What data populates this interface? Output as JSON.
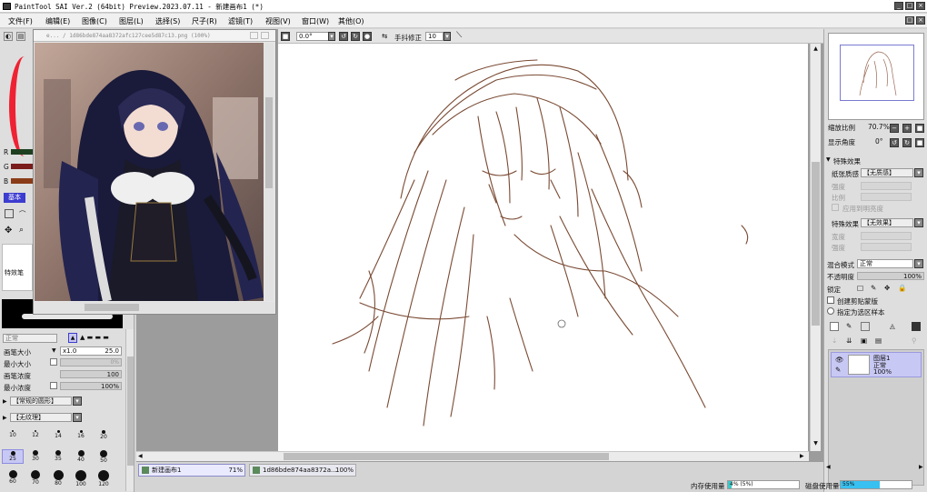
{
  "window": {
    "title": "PaintTool SAI Ver.2 (64bit) Preview.2023.07.11 - 新建画布1 (*)"
  },
  "menu": [
    "文件(F)",
    "编辑(E)",
    "图像(C)",
    "图层(L)",
    "选择(S)",
    "尺子(R)",
    "滤镜(T)",
    "视图(V)",
    "窗口(W)",
    "其他(O)"
  ],
  "toolbar": {
    "rotation": "0.0°",
    "stabilizer_label": "手抖修正",
    "stabilizer_value": "10"
  },
  "reference_window": {
    "title": "e... / 1d86bde874aa8372afc127cee5d87c13.png (100%)"
  },
  "left_panel": {
    "rgb_labels": [
      "R",
      "G",
      "B"
    ],
    "basic_tab": "基本",
    "special_pen": "特效笔",
    "blend_mode": "正常",
    "brush_size_label": "画笔大小",
    "brush_multiplier": "x1.0",
    "brush_size_value": "25.0",
    "min_size_label": "最小大小",
    "min_size_value": "0%",
    "density_label": "画笔浓度",
    "density_value": "100",
    "min_density_label": "最小浓度",
    "min_density_value": "100%",
    "shape_select": "【常规的圆形】",
    "texture_select": "【无纹理】",
    "brush_sizes": [
      "10",
      "12",
      "14",
      "16",
      "20",
      "25",
      "30",
      "35",
      "40",
      "50",
      "60",
      "70",
      "80",
      "100",
      "120"
    ]
  },
  "right_panel": {
    "zoom_label": "缩放比例",
    "zoom_value": "70.7%",
    "angle_label": "显示角度",
    "angle_value": "0°",
    "effects_header": "特殊效果",
    "paper_texture_label": "纸张质感",
    "paper_texture_value": "【无质感】",
    "strength_label": "强度",
    "scale_label": "比例",
    "apply_brightness": "应用到明亮度",
    "effect_label": "特殊效果",
    "effect_value": "【无效果】",
    "width_label": "宽度",
    "strength2_label": "强度",
    "blend_label": "混合模式",
    "blend_value": "正常",
    "opacity_label": "不透明度",
    "opacity_value": "100%",
    "lock_label": "锁定",
    "clip_label": "创建剪贴蒙版",
    "sample_label": "指定为选区样本",
    "layer_name": "图层1",
    "layer_mode": "正常",
    "layer_opacity": "100%"
  },
  "tabs": [
    {
      "name": "新建画布1",
      "zoom": "71%"
    },
    {
      "name": "1d86bde874aa8372a...",
      "zoom": "100%"
    }
  ],
  "status": {
    "memory_label": "内存使用量",
    "memory_value": "4% (5%)",
    "memory_fraction": 0.05,
    "disk_label": "磁盘使用量",
    "disk_value": "55%",
    "disk_fraction": 0.55
  },
  "colors": {
    "sketch_stroke": "#7a4a33",
    "selection_blue": "#3c3cd0"
  }
}
